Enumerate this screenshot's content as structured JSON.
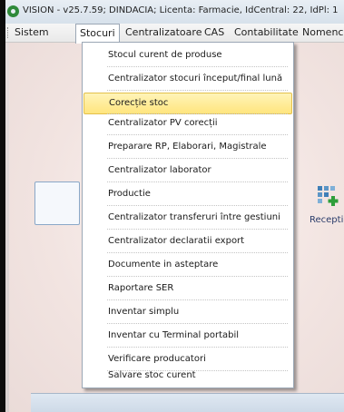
{
  "window": {
    "title": "VISION - v25.7.59; DINDACIA; Licenta: Farmacie, IdCentral: 22, IdPl: 1",
    "app_icon": "vision-app-icon"
  },
  "menubar": {
    "items": [
      {
        "label": "Sistem"
      },
      {
        "label": "Stocuri",
        "active": true
      },
      {
        "label": "Centralizatoare"
      },
      {
        "label": "CAS"
      },
      {
        "label": "Contabilitate"
      },
      {
        "label": "Nomenc"
      }
    ]
  },
  "stocuri_menu": {
    "items": [
      {
        "label": "Stocul curent de produse"
      },
      {
        "label": "Centralizator stocuri început/final lună"
      },
      {
        "label": "Corecție stoc",
        "highlighted": true
      },
      {
        "label": "Centralizator PV corecții"
      },
      {
        "label": "Preparare RP, Elaborari, Magistrale"
      },
      {
        "label": "Centralizator laborator"
      },
      {
        "label": "Productie"
      },
      {
        "label": "Centralizator transferuri între gestiuni"
      },
      {
        "label": "Centralizator declaratii export"
      },
      {
        "label": "Documente in asteptare"
      },
      {
        "label": "Raportare SER"
      },
      {
        "label": "Inventar simplu"
      },
      {
        "label": "Inventar cu Terminal portabil"
      },
      {
        "label": "Verificare producatori"
      },
      {
        "label": "Salvare stoc curent"
      }
    ]
  },
  "toolbar": {
    "receptie_label": "Receptie",
    "receptie_icon": "grid-add-icon"
  },
  "colors": {
    "highlight": "#ffe57e",
    "titlebar": "#dde6ee",
    "background": "#f2e4e1"
  }
}
